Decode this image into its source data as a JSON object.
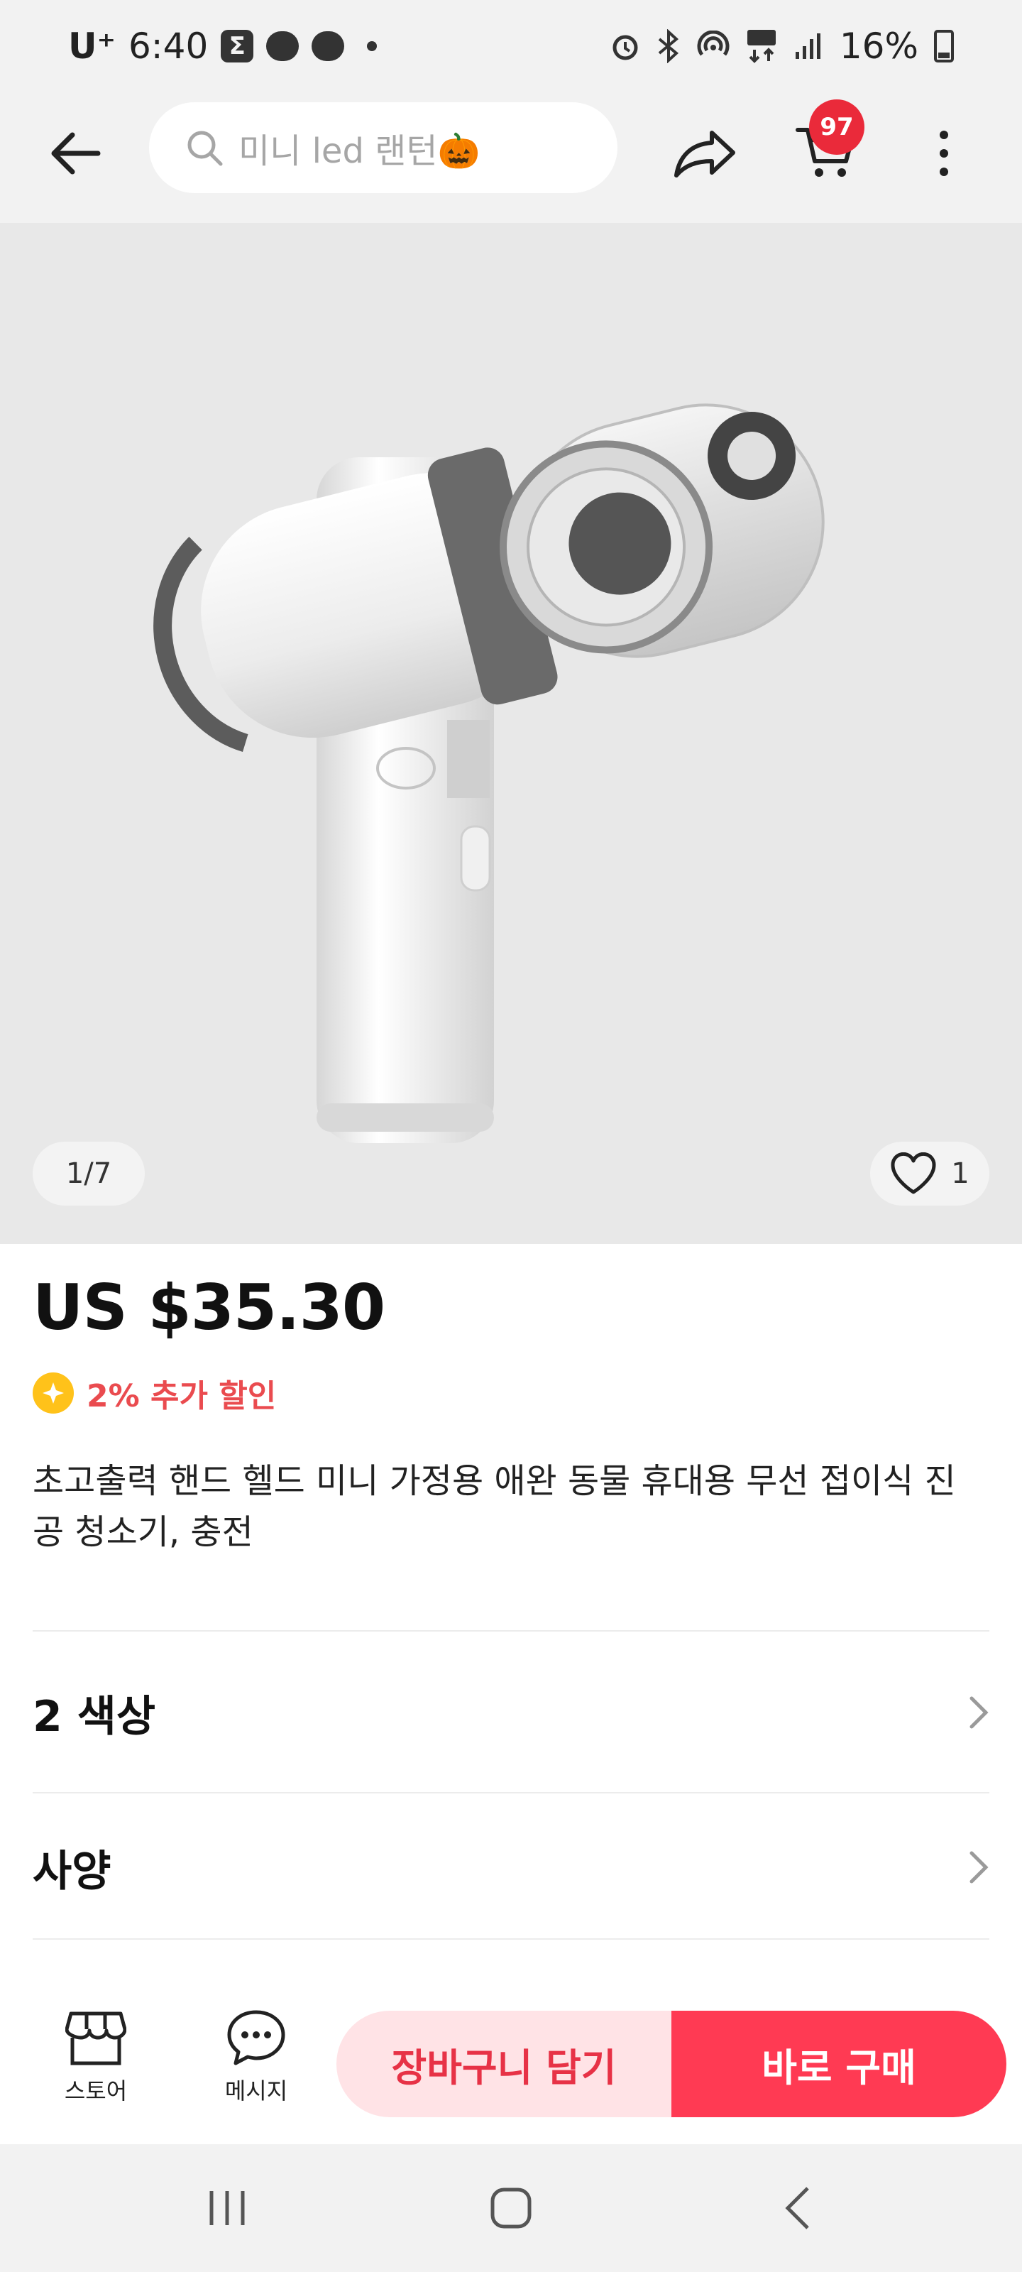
{
  "status_bar": {
    "carrier": "U⁺",
    "time": "6:40",
    "battery": "16%"
  },
  "search": {
    "placeholder": "미니 led 랜턴🎃"
  },
  "cart": {
    "badge_count": "97"
  },
  "product": {
    "image_counter": "1/7",
    "likes": "1",
    "price": "US $35.30",
    "discount": "2% 추가 할인",
    "title": "초고출력 핸드 헬드 미니 가정용 애완 동물 휴대용 무선 접이식 진공 청소기, 충전",
    "colors_label": "2 색상",
    "specs_label": "사양"
  },
  "actions": {
    "store_label": "스토어",
    "message_label": "메시지",
    "add_to_cart_label": "장바구니 담기",
    "buy_now_label": "바로 구매"
  },
  "colors": {
    "accent": "#ff3a53",
    "accent_light": "#ffe3e6",
    "badge": "#ea2a3a",
    "discount_text": "#ea4b4f",
    "coin": "#ffc21a"
  }
}
